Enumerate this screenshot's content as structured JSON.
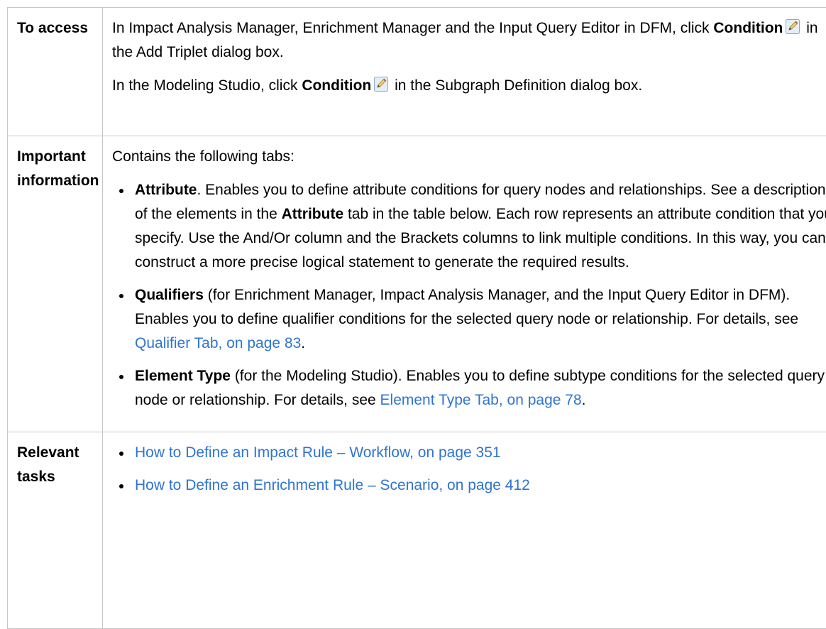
{
  "access": {
    "label": "To access",
    "p1": {
      "pre": "In Impact Analysis Manager, Enrichment Manager and the Input Query Editor in DFM, click ",
      "bold": "Condition",
      "post": " in the Add Triplet dialog box."
    },
    "p2": {
      "pre": "In the Modeling Studio, click ",
      "bold": "Condition",
      "post": " in the Subgraph Definition dialog box."
    },
    "icon": "pencil-edit-icon"
  },
  "important": {
    "label_line1": "Important",
    "label_line2": "information",
    "intro": "Contains the following tabs:",
    "items": [
      {
        "bold": "Attribute",
        "text1": ". Enables you to define attribute conditions for query nodes and relationships. See a description of the elements in the ",
        "bold2": "Attribute",
        "text2": " tab in the table below. Each row represents an attribute condition that you specify. Use the And/Or column and the Brackets columns to link multiple conditions. In this way, you can construct a more precise logical statement to generate the required results."
      },
      {
        "bold": "Qualifiers",
        "text1": " (for Enrichment Manager, Impact Analysis Manager, and the Input Query Editor in DFM). Enables you to define qualifier conditions for the selected query node or relationship. For details, see ",
        "link": "Qualifier Tab, on page 83",
        "text2": "."
      },
      {
        "bold": "Element Type",
        "text1": " (for the Modeling Studio). Enables you to define subtype conditions for the selected query node or relationship. For details, see ",
        "link": "Element Type Tab, on page 78",
        "text2": "."
      }
    ]
  },
  "relevant": {
    "label_line1": "Relevant",
    "label_line2": "tasks",
    "links": [
      "How to Define an Impact Rule – Workflow, on page 351",
      "How to Define an Enrichment Rule – Scenario, on page 412"
    ]
  },
  "colors": {
    "link": "#2f74d0",
    "border": "#c6c6c6"
  }
}
